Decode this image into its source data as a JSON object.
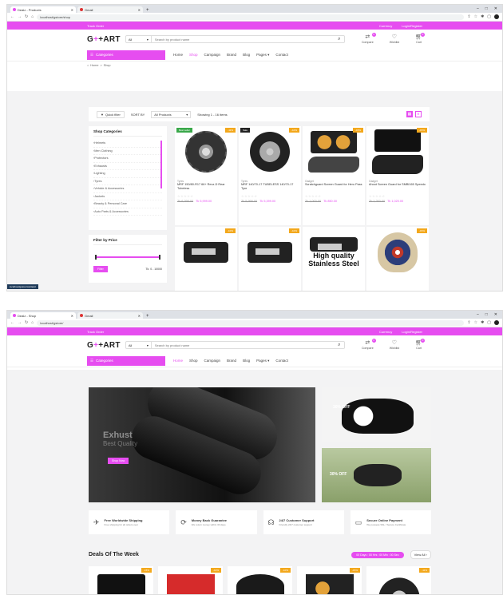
{
  "screens": [
    {
      "tabs": [
        {
          "title": "Dealz - Products"
        },
        {
          "title": "Gmail"
        }
      ],
      "url": "localhost/gstore/shop",
      "topbar": {
        "left": "Track Order",
        "currency": "Currency",
        "login": "Login/Register"
      },
      "logo": {
        "a": "G",
        "b": "+",
        "c": "+ART"
      },
      "search": {
        "category": "All",
        "placeholder": "Search by product name"
      },
      "header_icons": [
        {
          "label": "Compare",
          "badge": "0"
        },
        {
          "label": "Wishlist",
          "badge": ""
        },
        {
          "label": "Cart",
          "badge": "0"
        }
      ],
      "nav": {
        "categories": "Categories",
        "items": [
          "Home",
          "Shop",
          "Campaign",
          "Brand",
          "Blog",
          "Pages",
          "Contact"
        ],
        "active": "Shop"
      },
      "breadcrumb": [
        "Home",
        ">",
        "Shop"
      ],
      "toolbar": {
        "quick_filter": "Quick filter",
        "sort_label": "SORT BY",
        "sort_value": "All Products",
        "showing": "Showing 1 - 16 items"
      },
      "sidebar": {
        "title": "Shop Categories",
        "items": [
          "Helmets",
          "Men Clothing",
          "Protectors",
          "Exhausts",
          "Lighting",
          "Tyres",
          "Vehicle & Accessories",
          "Jackets",
          "Beauty & Personal Care",
          "Auto Parts & Accessories"
        ]
      },
      "price_filter": {
        "title": "Filter by Price",
        "button": "Filter",
        "range": "Tk: 0 - 10000"
      },
      "products": [
        {
          "label": "Best seller",
          "discount": "-11%",
          "category": "Tyres",
          "name": "MRF 150/80-R17 66+ Revz-D Rear Tubeless",
          "old": "Tk 6,399.00",
          "new": "Tk 5,999.00",
          "img": "tire"
        },
        {
          "label": "Sale",
          "discount": "-10%",
          "category": "Tyres",
          "name": "MRF 140/70-17 TUBELESS 140/70-17 Tyre",
          "old": "Tk 5,999.00",
          "new": "Tk 5,399.00",
          "img": "tire2"
        },
        {
          "label": "",
          "discount": "-15%",
          "category": "Gadget",
          "name": "Scratchguard Screen Guard for Hero Pass",
          "old": "Tk 1,000.00",
          "new": "Tk 850.00",
          "img": "dash"
        },
        {
          "label": "",
          "discount": "-15%",
          "category": "Gadget",
          "name": "Ahoot Screen Guard for SMBI165 Speedo",
          "old": "Tk 1,200.00",
          "new": "Tk 1,020.00",
          "img": "dash2"
        },
        {
          "label": "",
          "discount": "-10%",
          "category": "",
          "name": "",
          "old": "",
          "new": "",
          "img": "exhaust"
        },
        {
          "label": "",
          "discount": "-10%",
          "category": "",
          "name": "",
          "old": "",
          "new": "",
          "img": "exhaust"
        },
        {
          "label": "",
          "discount": "",
          "category": "",
          "name": "",
          "old": "",
          "new": "",
          "img": "hq",
          "hq_text": "High quality Stainless Steel"
        },
        {
          "label": "",
          "discount": "-15%",
          "category": "",
          "name": "",
          "old": "",
          "new": "",
          "img": "helmet"
        }
      ],
      "status_url": "localhost/gstore/cart/add"
    },
    {
      "tabs": [
        {
          "title": "Dealz - Shop"
        },
        {
          "title": "Gmail"
        }
      ],
      "url": "localhost/gstore/",
      "topbar": {
        "left": "Track Order",
        "currency": "Currency",
        "login": "Login/Register"
      },
      "logo": {
        "a": "G",
        "b": "+",
        "c": "+ART"
      },
      "search": {
        "category": "All",
        "placeholder": "Search by product name"
      },
      "header_icons": [
        {
          "label": "Compare",
          "badge": "0"
        },
        {
          "label": "Wishlist",
          "badge": ""
        },
        {
          "label": "Cart",
          "badge": "0"
        }
      ],
      "nav": {
        "categories": "Categories",
        "items": [
          "Home",
          "Shop",
          "Campaign",
          "Brand",
          "Blog",
          "Pages",
          "Contact"
        ],
        "active": "Home"
      },
      "hero": {
        "title": "Exhust",
        "subtitle": "Best Quality",
        "button": "Shop Now"
      },
      "side_banners": [
        {
          "text": "30% OFF"
        },
        {
          "text": "30% OFF"
        }
      ],
      "features": [
        {
          "title": "Free Worldwide Shipping",
          "sub": "Free shipping for all orders over"
        },
        {
          "title": "Money Back Guarantee",
          "sub": "We return money within 30 days"
        },
        {
          "title": "24/7 Customer Support",
          "sub": "Friendly 24/7 customer support"
        },
        {
          "title": "Secure Online Payment",
          "sub": "We possess SSL / Secure Certificate"
        }
      ],
      "deals": {
        "title": "Deals Of The Week",
        "timer": "00 Days : 00 Hrs : 00 Min : 00 Sec",
        "view_all": "View All"
      },
      "deal_discounts": [
        "-15%",
        "-10%",
        "-10%",
        "-15%",
        "-11%"
      ]
    }
  ]
}
